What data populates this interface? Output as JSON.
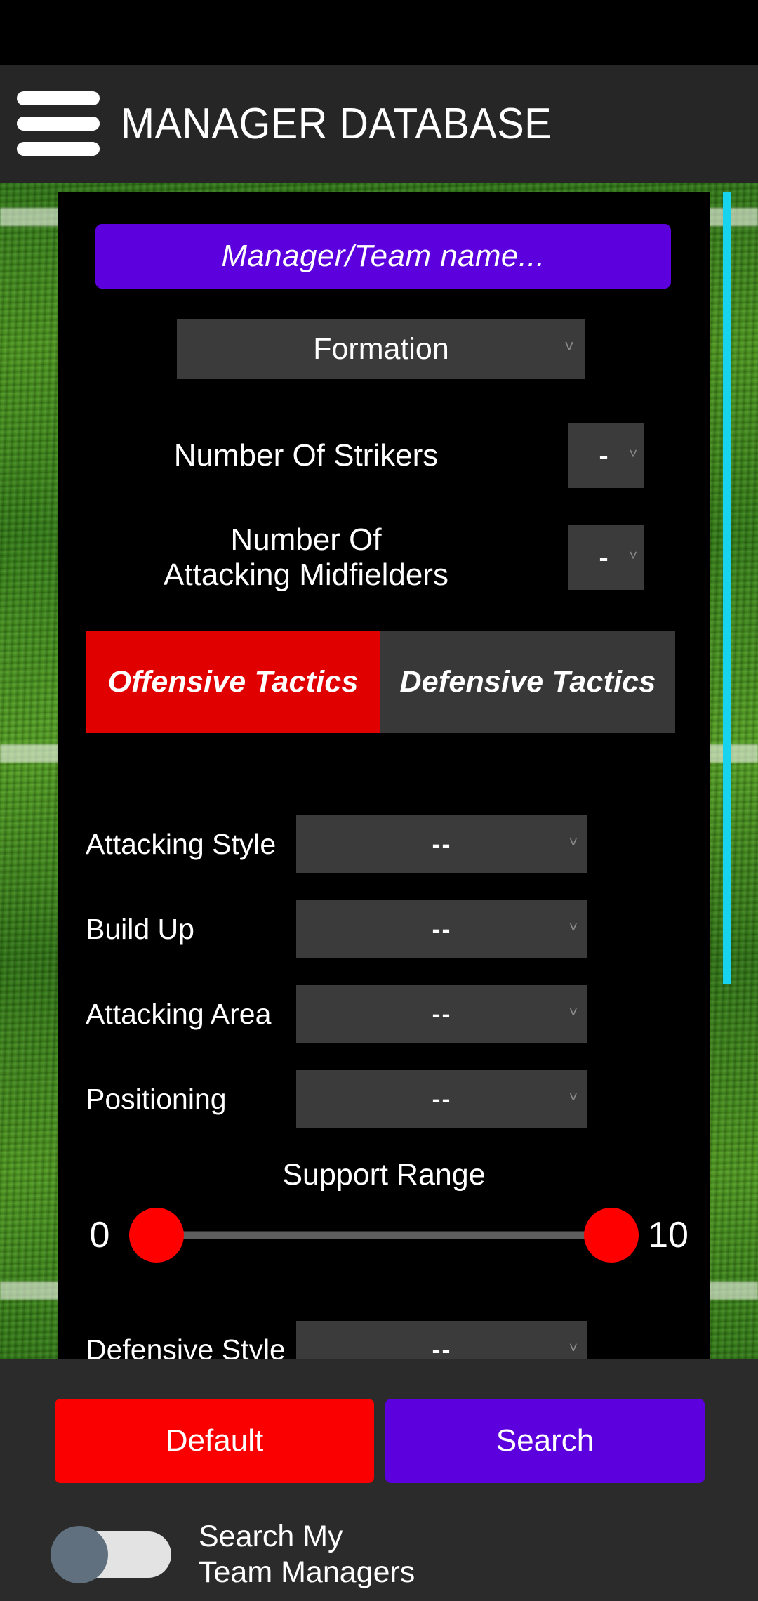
{
  "app": {
    "title": "MANAGER DATABASE",
    "menu_icon": "hamburger-menu-icon",
    "accent_purple": "#5C00DD",
    "accent_red": "#E00000",
    "accent_cyan": "#17D3EE",
    "panel_gray": "#3B3B3B"
  },
  "search": {
    "name_placeholder": "Manager/Team name..."
  },
  "formation": {
    "label": "Formation",
    "chevron": "chevron-down-icon"
  },
  "counts": [
    {
      "label": "Number Of Strikers",
      "value": "-"
    },
    {
      "label_line1": "Number Of",
      "label_line2": "Attacking Midfielders",
      "value": "-"
    }
  ],
  "tabs": [
    {
      "label": "Offensive Tactics",
      "active": true
    },
    {
      "label": "Defensive Tactics",
      "active": false
    }
  ],
  "attributes": [
    {
      "label": "Attacking Style",
      "value": "--"
    },
    {
      "label": "Build Up",
      "value": "--"
    },
    {
      "label": "Attacking Area",
      "value": "--"
    },
    {
      "label": "Positioning",
      "value": "--"
    }
  ],
  "slider": {
    "title": "Support Range",
    "min_label": "0",
    "max_label": "10",
    "min_value": 0,
    "max_value": 10
  },
  "cutoff_row": {
    "label": "Defensive Style",
    "value": "--"
  },
  "footer": {
    "default_label": "Default",
    "search_label": "Search",
    "toggle_label_line1": "Search My",
    "toggle_label_line2": "Team Managers",
    "toggle_state": "off"
  }
}
